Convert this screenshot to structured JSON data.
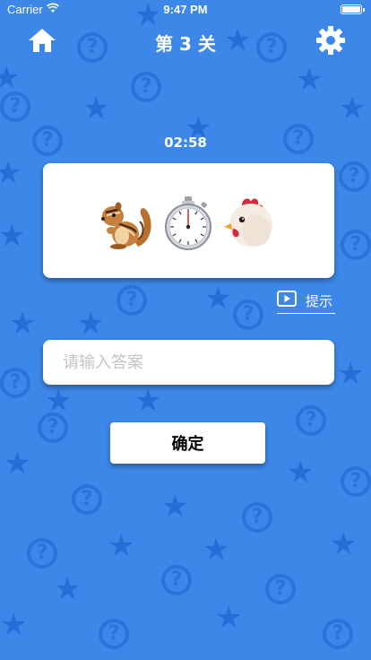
{
  "status_bar": {
    "carrier": "Carrier",
    "time": "9:47 PM"
  },
  "nav": {
    "title": "第 3 关",
    "home_icon": "home-icon",
    "settings_icon": "gear-icon"
  },
  "timer": "02:58",
  "puzzle": {
    "emojis": [
      "chipmunk",
      "stopwatch",
      "chicken"
    ]
  },
  "hint": {
    "label": "提示",
    "icon": "play-icon"
  },
  "answer": {
    "placeholder": "请输入答案",
    "value": ""
  },
  "confirm_label": "确定",
  "colors": {
    "background": "#3c87e8",
    "card": "#ffffff"
  }
}
